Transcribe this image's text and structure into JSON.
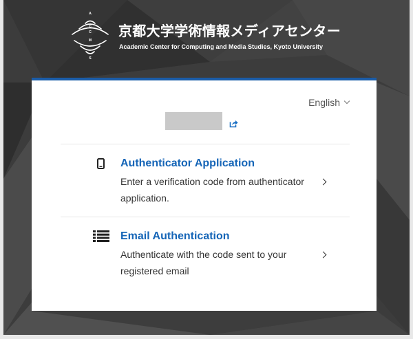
{
  "header": {
    "org_name_ja": "京都大学学術情報メディアセンター",
    "org_name_en": "Academic Center for Computing and Media Studies, Kyoto University",
    "logo_letters": [
      "A",
      "C",
      "C",
      "M",
      "S"
    ]
  },
  "language_selector": {
    "selected": "English",
    "icon": "chevron-down-icon"
  },
  "account": {
    "link_icon": "external-link-icon"
  },
  "methods": [
    {
      "title": "Authenticator Application",
      "description": "Enter a verification code from authenticator application.",
      "icon": "mobile-phone-icon",
      "chevron_icon": "chevron-right-icon"
    },
    {
      "title": "Email Authentication",
      "description": "Authenticate with the code sent to your registered email",
      "icon": "list-icon",
      "chevron_icon": "chevron-right-icon"
    }
  ],
  "colors": {
    "accent": "#1a5ca8",
    "title": "#1565b7",
    "link": "#1a6fc4",
    "page": "#3c3c3c",
    "card": "#ffffff",
    "placeholder": "#c9c9c9"
  }
}
